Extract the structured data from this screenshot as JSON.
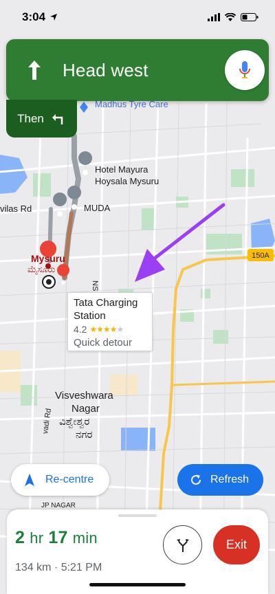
{
  "status_bar": {
    "time": "3:04"
  },
  "navigation": {
    "instruction": "Head west",
    "then_label": "Then"
  },
  "map": {
    "labels": {
      "madhus": "Madhus Tyre Care",
      "hotel_line1": "Hotel Mayura",
      "hotel_line2": "Hoysala Mysuru",
      "muda": "MUDA",
      "vilas_rd": "vilas Rd",
      "mysuru": "Mysuru",
      "mysuru_kannada": "ಮೈಸೂರು",
      "ns": "NS",
      "highway": "150A",
      "visveshwara1": "Visveshwara",
      "visveshwara2": "Nagar",
      "visveshwara_kn1": "ವಿಶ್ವೇಶ್ವರ",
      "visveshwara_kn2": "ನಗರ",
      "vadi_rd": "vadi Rd",
      "jp_nagar": "JP NAGAR"
    },
    "callout": {
      "name": "Tata Charging Station",
      "rating": "4.2",
      "stars_value": 4.2,
      "detour": "Quick detour"
    }
  },
  "buttons": {
    "recentre": "Re-centre",
    "refresh": "Refresh",
    "exit": "Exit"
  },
  "trip": {
    "hours": "2",
    "hours_unit": "hr",
    "minutes": "17",
    "minutes_unit": "min",
    "details": "134 km · 5:21 PM"
  },
  "colors": {
    "nav_green": "#2e7d32",
    "eta_green": "#188038",
    "accent_blue": "#1a73e8",
    "exit_red": "#d93025",
    "annotation_purple": "#9b3ff2"
  }
}
